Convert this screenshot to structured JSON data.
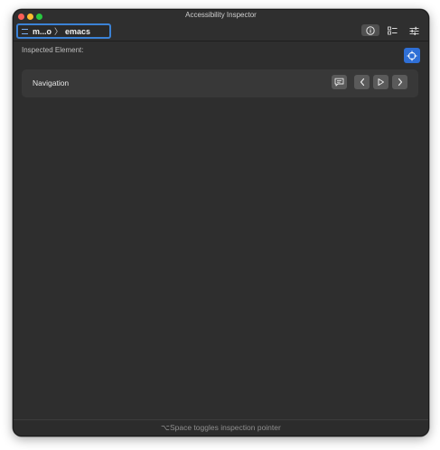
{
  "window": {
    "title": "Accessibility Inspector"
  },
  "toolbar": {
    "target": {
      "app": "m...o",
      "separator": "〉",
      "element": "emacs"
    },
    "buttons": [
      {
        "name": "inspector-info",
        "icon": "info-icon",
        "active": true
      },
      {
        "name": "audit",
        "icon": "checklist-icon",
        "active": false
      },
      {
        "name": "settings",
        "icon": "sliders-icon",
        "active": false
      }
    ]
  },
  "inspector": {
    "label": "Inspected Element:",
    "pointer_icon": "crosshair-icon"
  },
  "navigation": {
    "title": "Navigation",
    "buttons": [
      {
        "name": "speak",
        "icon": "speech-bubble-icon"
      },
      {
        "name": "previous",
        "icon": "chevron-left-icon"
      },
      {
        "name": "play",
        "icon": "play-icon"
      },
      {
        "name": "next",
        "icon": "chevron-right-icon"
      }
    ]
  },
  "footer": {
    "hint": "⌥Space toggles inspection pointer"
  },
  "colors": {
    "accent": "#2f6fd6",
    "window_bg": "#2e2e2e",
    "panel_bg": "#383838"
  }
}
